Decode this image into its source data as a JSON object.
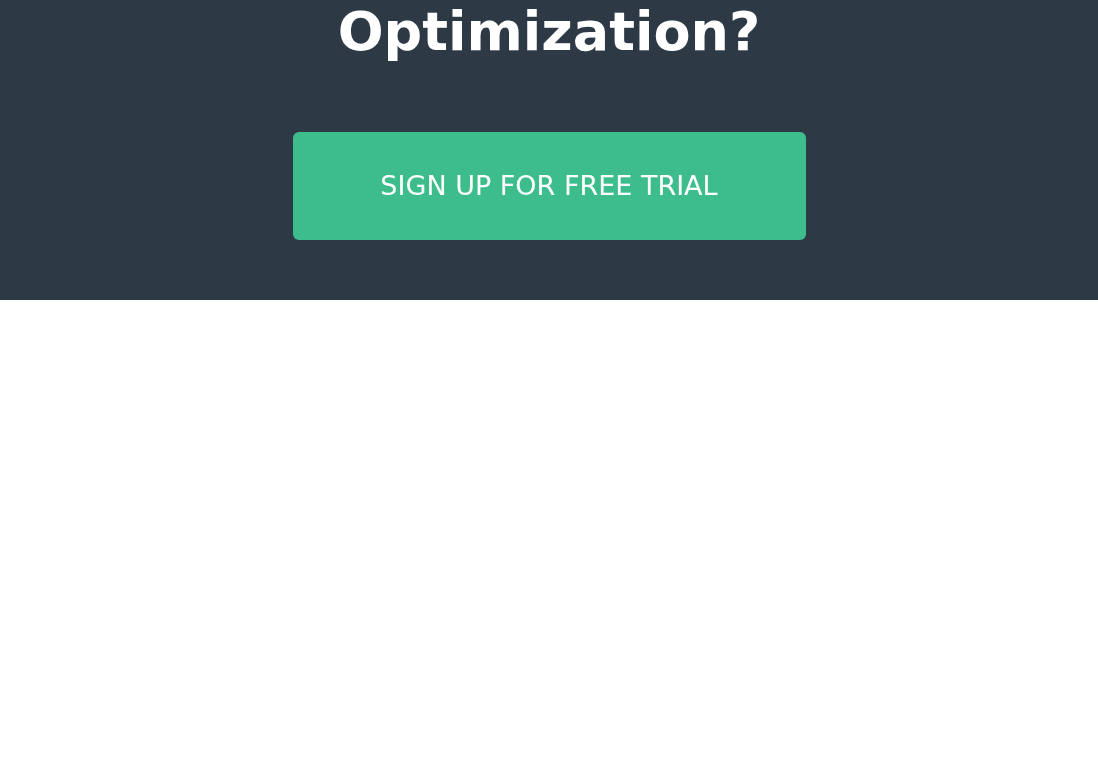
{
  "heading": "Optimization?",
  "cta_button": "SIGN UP FOR FREE TRIAL"
}
